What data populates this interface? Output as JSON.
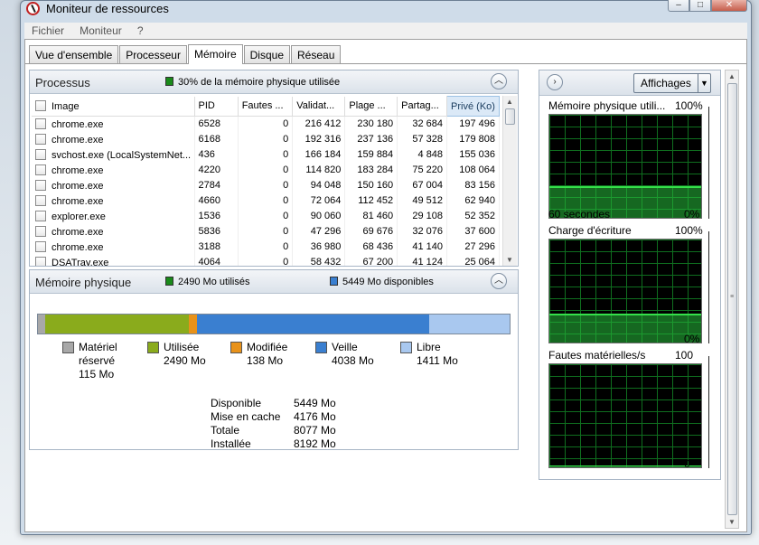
{
  "window": {
    "title": "Moniteur de ressources",
    "btn_min": "–",
    "btn_max": "□",
    "btn_close": "✕"
  },
  "menu": [
    "Fichier",
    "Moniteur",
    "?"
  ],
  "tabs": [
    {
      "label": "Vue d'ensemble",
      "active": false
    },
    {
      "label": "Processeur",
      "active": false
    },
    {
      "label": "Mémoire",
      "active": true
    },
    {
      "label": "Disque",
      "active": false
    },
    {
      "label": "Réseau",
      "active": false
    }
  ],
  "processus": {
    "title": "Processus",
    "status": "30% de la mémoire physique utilisée",
    "status_color": "#1a8a1a",
    "columns": [
      "Image",
      "PID",
      "Fautes ...",
      "Validat...",
      "Plage ...",
      "Partag...",
      "Privé (Ko)"
    ],
    "rows": [
      [
        "chrome.exe",
        "6528",
        "0",
        "216 412",
        "230 180",
        "32 684",
        "197 496"
      ],
      [
        "chrome.exe",
        "6168",
        "0",
        "192 316",
        "237 136",
        "57 328",
        "179 808"
      ],
      [
        "svchost.exe (LocalSystemNet...",
        "436",
        "0",
        "166 184",
        "159 884",
        "4 848",
        "155 036"
      ],
      [
        "chrome.exe",
        "4220",
        "0",
        "114 820",
        "183 284",
        "75 220",
        "108 064"
      ],
      [
        "chrome.exe",
        "2784",
        "0",
        "94 048",
        "150 160",
        "67 004",
        "83 156"
      ],
      [
        "chrome.exe",
        "4660",
        "0",
        "72 064",
        "112 452",
        "49 512",
        "62 940"
      ],
      [
        "explorer.exe",
        "1536",
        "0",
        "90 060",
        "81 460",
        "29 108",
        "52 352"
      ],
      [
        "chrome.exe",
        "5836",
        "0",
        "47 296",
        "69 676",
        "32 076",
        "37 600"
      ],
      [
        "chrome.exe",
        "3188",
        "0",
        "36 980",
        "68 436",
        "41 140",
        "27 296"
      ],
      [
        "DSATray.exe",
        "4064",
        "0",
        "58 432",
        "67 200",
        "41 124",
        "25 064"
      ]
    ]
  },
  "memoire": {
    "title": "Mémoire physique",
    "used_label": "2490 Mo utilisés",
    "avail_label": "5449 Mo disponibles",
    "used_color": "#1a8a1a",
    "avail_color": "#3a7fd0",
    "segments": [
      {
        "name": "Matériel réservé",
        "value": 115,
        "color": "#a8a8a8"
      },
      {
        "name": "Utilisée",
        "value": 2490,
        "color": "#8aab1c"
      },
      {
        "name": "Modifiée",
        "value": 138,
        "color": "#e8921a"
      },
      {
        "name": "Veille",
        "value": 4038,
        "color": "#3a7fd0"
      },
      {
        "name": "Libre",
        "value": 1411,
        "color": "#a9c8ef"
      }
    ],
    "legend": [
      {
        "l1": "Matériel",
        "l2": "réservé",
        "l3": "115 Mo"
      },
      {
        "l1": "Utilisée",
        "l2": "2490 Mo",
        "l3": ""
      },
      {
        "l1": "Modifiée",
        "l2": "138 Mo",
        "l3": ""
      },
      {
        "l1": "Veille",
        "l2": "4038 Mo",
        "l3": ""
      },
      {
        "l1": "Libre",
        "l2": "1411 Mo",
        "l3": ""
      }
    ],
    "stats": [
      {
        "k": "Disponible",
        "v": "5449 Mo"
      },
      {
        "k": "Mise en cache",
        "v": "4176 Mo"
      },
      {
        "k": "Totale",
        "v": "8077 Mo"
      },
      {
        "k": "Installée",
        "v": "8192 Mo"
      }
    ]
  },
  "right": {
    "views_label": "Affichages",
    "graphs": [
      {
        "title": "Mémoire physique utili...",
        "max": "100%",
        "left_label": "60 secondes",
        "min": "0%",
        "level": 0.3
      },
      {
        "title": "Charge d'écriture",
        "max": "100%",
        "left_label": "",
        "min": "0%",
        "level": 0.28
      },
      {
        "title": "Fautes matérielles/s",
        "max": "100",
        "left_label": "",
        "min": "0",
        "level": 0.02
      }
    ]
  },
  "icons": {
    "collapse": "chevron-up-icon",
    "expand_right": "chevron-right-icon",
    "dropdown": "triangle-down-icon"
  }
}
